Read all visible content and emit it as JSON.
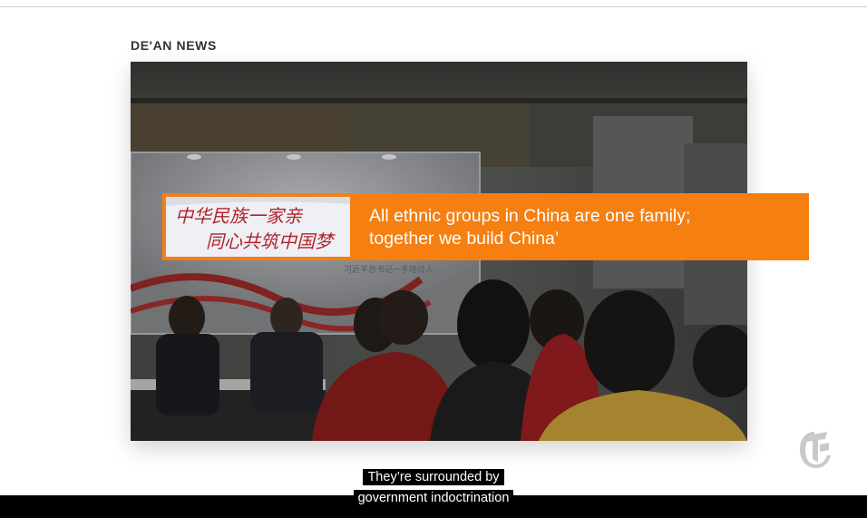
{
  "source_label": "DE'AN NEWS",
  "video": {
    "banner_text_cn_line1": "中华民族一家亲",
    "banner_text_cn_line2": "同心共筑中国梦",
    "banner_subtext_cn": "习近平总书记一手培过人"
  },
  "callout": {
    "thumbnail_cn_line1": "中华民族一家亲",
    "thumbnail_cn_line2": "同心共筑中国梦",
    "text_line1": "All ethnic groups in China are one family;",
    "text_line2": "together we build China’"
  },
  "caption": {
    "line1": "They’re surrounded by",
    "line2": "government indoctrination"
  },
  "logo": {
    "icon": "nyt-t-logo-icon",
    "color": "#c9c9c9"
  },
  "colors": {
    "callout_bg": "#f57f11",
    "caption_bg": "#000000",
    "bottom_bar": "#000000"
  }
}
